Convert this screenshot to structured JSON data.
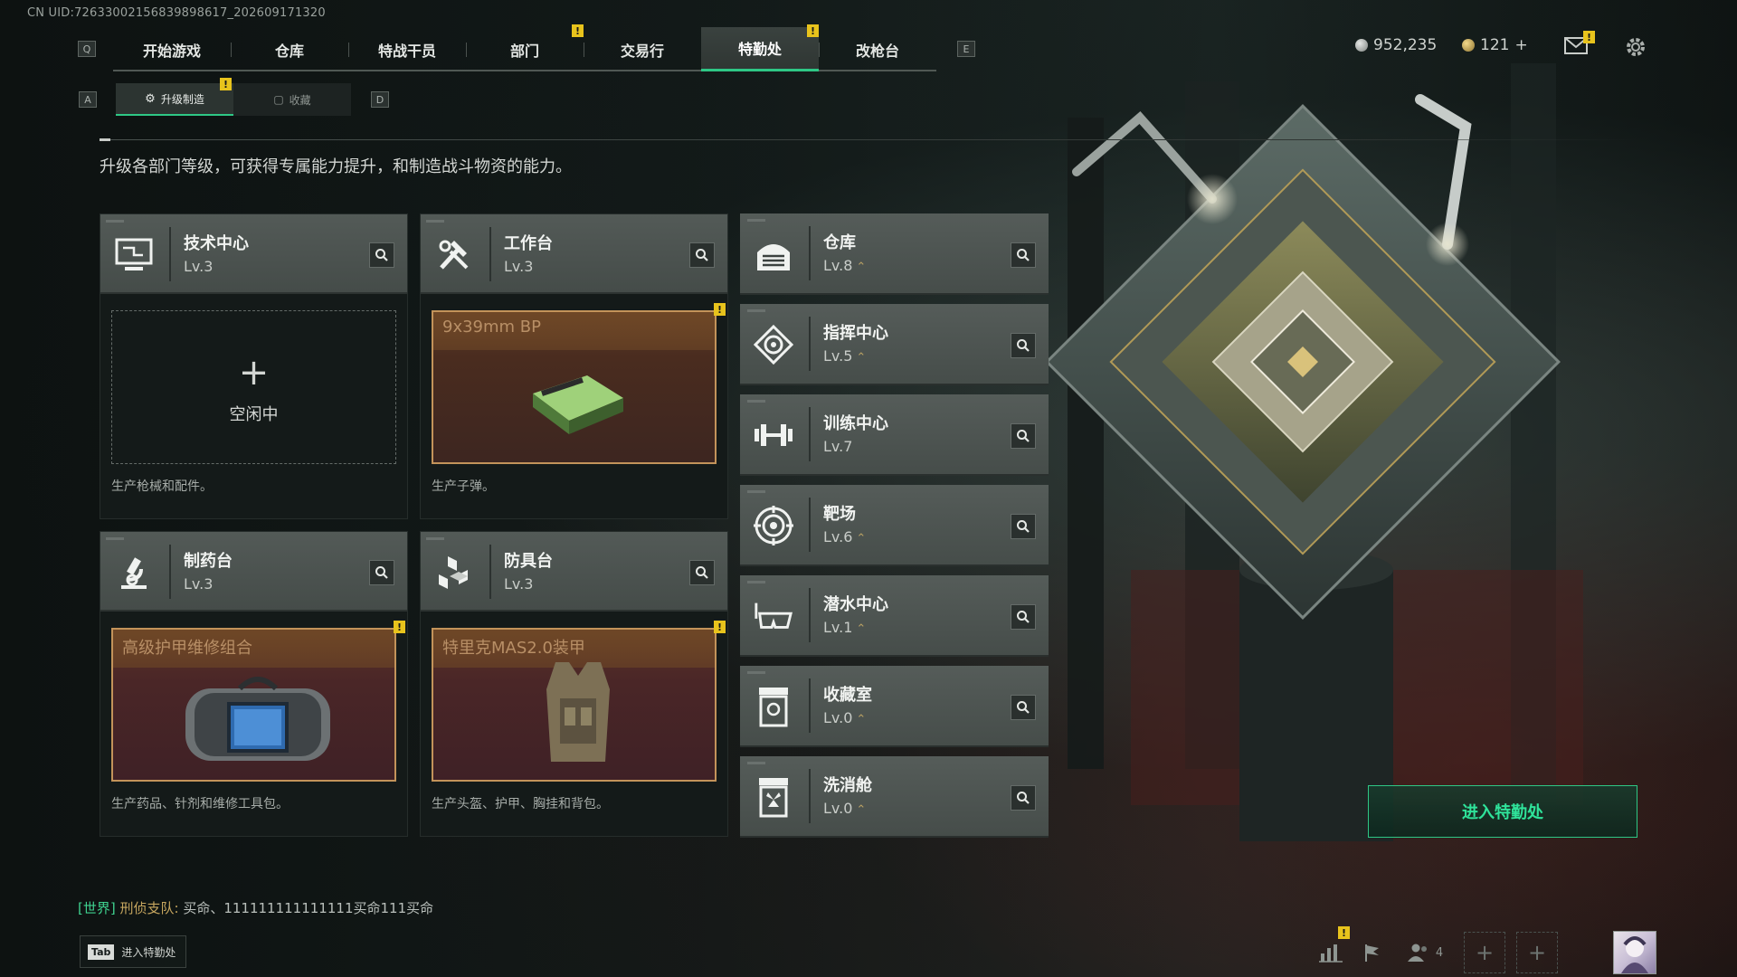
{
  "uid_text": "CN UID:726330021568398986​17_202609171320",
  "key_hints": {
    "left": "Q",
    "right": "E",
    "sub_left": "A",
    "sub_right": "D"
  },
  "top_tabs": [
    {
      "label": "开始游戏"
    },
    {
      "label": "仓库"
    },
    {
      "label": "特战干员"
    },
    {
      "label": "部门",
      "badge": "!"
    },
    {
      "label": "交易行"
    },
    {
      "label": "特勤处",
      "badge": "!",
      "active": true
    },
    {
      "label": "改枪台"
    }
  ],
  "currency": {
    "silver": "952,235",
    "gold": "121",
    "gold_plus": "+"
  },
  "sub_tabs": [
    {
      "label": "升级制造",
      "active": true,
      "badge": "!"
    },
    {
      "label": "收藏"
    }
  ],
  "description": "升级各部门等级，可获得专属能力提升，和制造战斗物资的能力。",
  "departments": {
    "tech": {
      "name": "技术中心",
      "level": "Lv.3",
      "slot_state": "空闲中",
      "slot_desc": "生产枪械和配件。"
    },
    "workbench": {
      "name": "工作台",
      "level": "Lv.3",
      "item": "9x39mm BP",
      "slot_desc": "生产子弹。"
    },
    "pharmacy": {
      "name": "制药台",
      "level": "Lv.3",
      "item": "高级护甲维修组合",
      "slot_desc": "生产药品、针剂和维修工具包。"
    },
    "armor": {
      "name": "防具台",
      "level": "Lv.3",
      "item": "特里克MAS2.0装甲",
      "slot_desc": "生产头盔、护甲、胸挂和背包。"
    }
  },
  "facilities": [
    {
      "name": "仓库",
      "level": "Lv.8",
      "upgradable": true,
      "icon": "storage-icon"
    },
    {
      "name": "指挥中心",
      "level": "Lv.5",
      "upgradable": true,
      "icon": "command-icon"
    },
    {
      "name": "训练中心",
      "level": "Lv.7",
      "upgradable": false,
      "icon": "dumbbell-icon"
    },
    {
      "name": "靶场",
      "level": "Lv.6",
      "upgradable": true,
      "icon": "target-icon"
    },
    {
      "name": "潜水中心",
      "level": "Lv.1",
      "upgradable": true,
      "icon": "diving-mask-icon"
    },
    {
      "name": "收藏室",
      "level": "Lv.0",
      "upgradable": true,
      "icon": "collection-icon"
    },
    {
      "name": "洗消舱",
      "level": "Lv.0",
      "upgradable": true,
      "icon": "decon-icon"
    }
  ],
  "enter_button": "进入特勤处",
  "chat": {
    "channel": "[世界]",
    "sender": "刑侦支队:",
    "message": " 买命、111111111111111买命111买命"
  },
  "tab_hint": {
    "key": "Tab",
    "label": "进入特勤处"
  },
  "squad_count": "4",
  "colors": {
    "accent": "#2ec785",
    "badge": "#e8c31c",
    "slot_border": "#c3935a"
  }
}
